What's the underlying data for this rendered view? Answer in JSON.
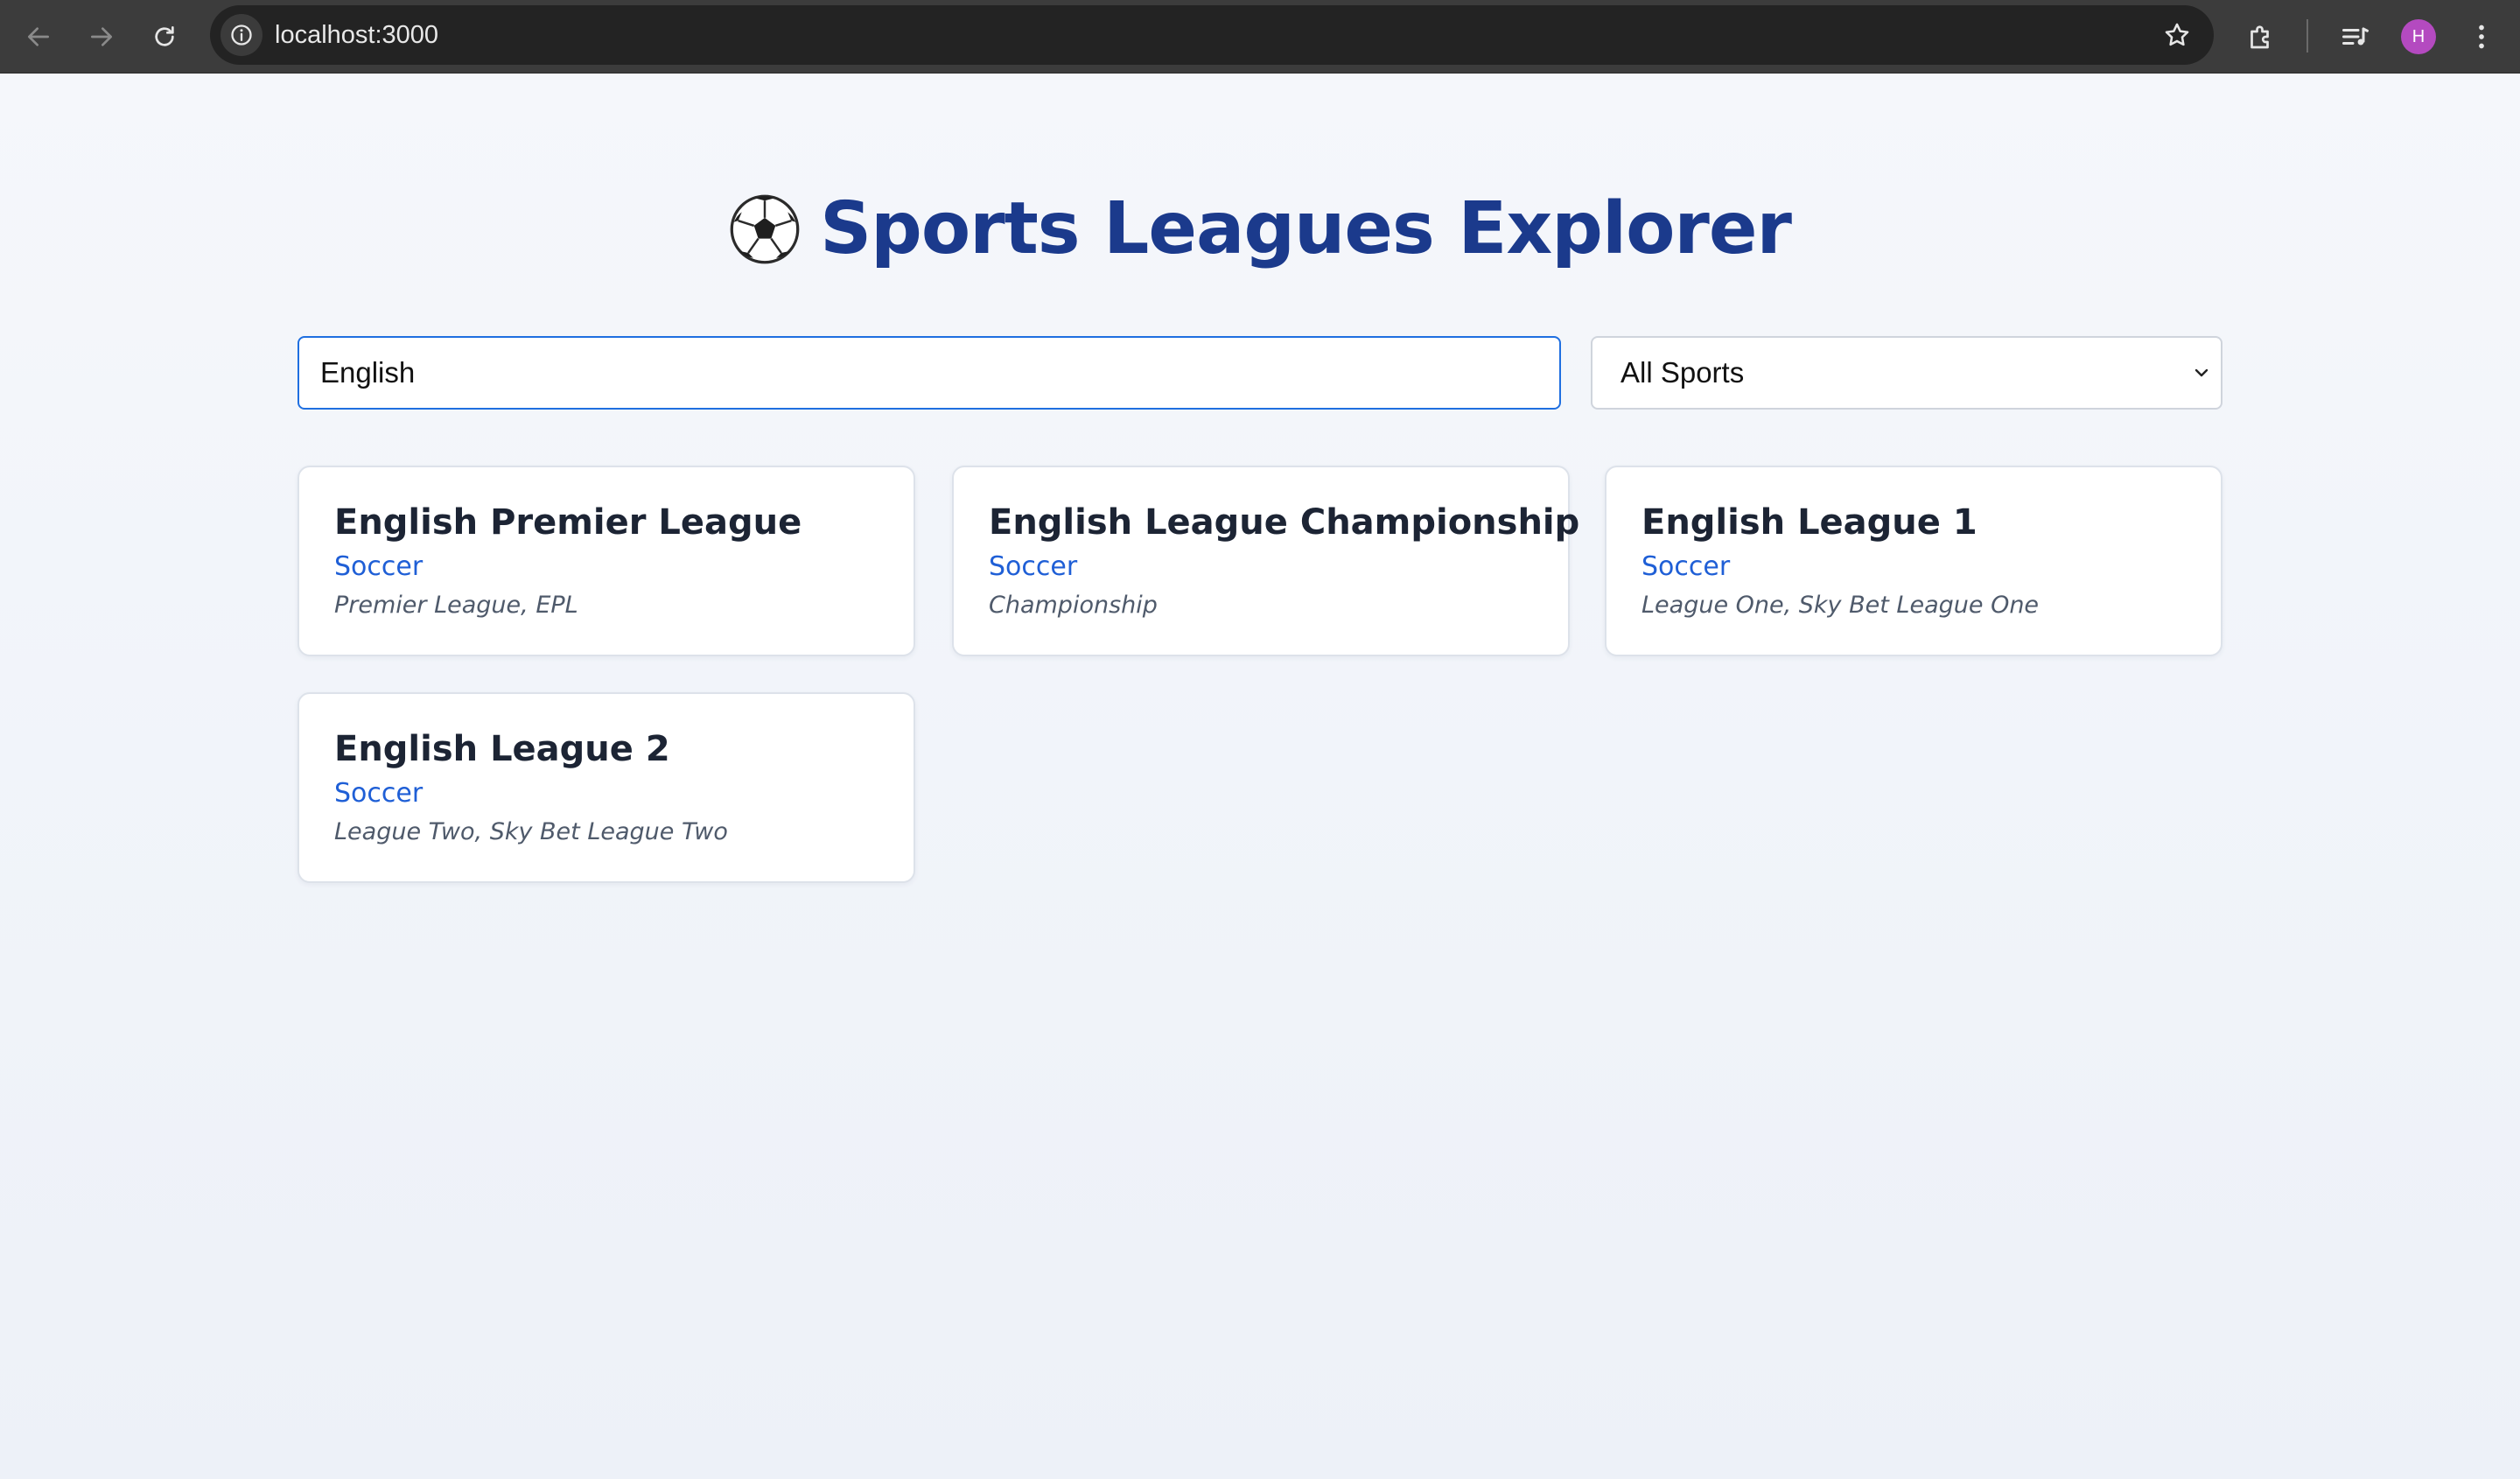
{
  "browser": {
    "url": "localhost:3000",
    "profile_initial": "H",
    "icons": {
      "back": "back-arrow-icon",
      "forward": "forward-arrow-icon",
      "reload": "reload-icon",
      "site_info": "info-icon",
      "bookmark": "star-icon",
      "extensions": "puzzle-icon",
      "media": "media-queue-icon",
      "menu": "kebab-menu-icon"
    },
    "colors": {
      "toolbar": "#3c3c3c",
      "omnibox": "#232323",
      "avatar": "#b44ac0"
    }
  },
  "header": {
    "title": "Sports Leagues Explorer",
    "icon": "soccer-ball-icon"
  },
  "filters": {
    "search_value": "English",
    "sport_select": {
      "selected": "All Sports"
    }
  },
  "leagues": [
    {
      "name": "English Premier League",
      "sport": "Soccer",
      "alternates": "Premier League, EPL"
    },
    {
      "name": "English League Championship",
      "sport": "Soccer",
      "alternates": "Championship"
    },
    {
      "name": "English League 1",
      "sport": "Soccer",
      "alternates": "League One, Sky Bet League One"
    },
    {
      "name": "English League 2",
      "sport": "Soccer",
      "alternates": "League Two, Sky Bet League Two"
    }
  ],
  "colors": {
    "title": "#1b3a8c",
    "sport_link": "#1f5fd6",
    "search_focus_border": "#1f6fe0",
    "card_border": "#dde2ea"
  }
}
